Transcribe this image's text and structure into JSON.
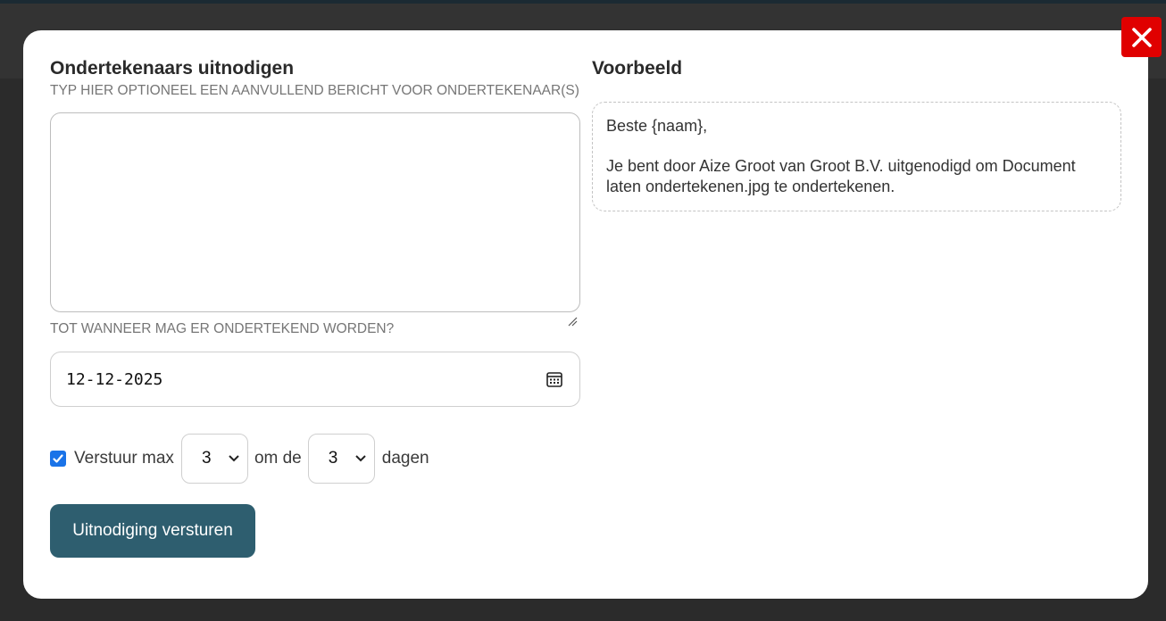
{
  "invite": {
    "title": "Ondertekenaars uitnodigen",
    "message_caption": "TYP HIER OPTIONEEL EEN AANVULLEND BERICHT VOOR ONDERTEKENAAR(S)",
    "message_value": "",
    "deadline_caption": "TOT WANNEER MAG ER ONDERTEKEND WORDEN?",
    "deadline_value": "12-12-2025",
    "reminder": {
      "checked": true,
      "label_prefix": "Verstuur max",
      "count_value": "3",
      "label_middle": "om de",
      "interval_value": "3",
      "label_suffix": "dagen"
    },
    "submit_label": "Uitnodiging versturen"
  },
  "preview": {
    "title": "Voorbeeld",
    "greeting": "Beste {naam},",
    "body": "Je bent door Aize Groot van Groot B.V. uitgenodigd om Document laten ondertekenen.jpg te ondertekenen."
  },
  "colors": {
    "close_button": "#e00000",
    "submit_button": "#2e5e6f",
    "checkbox": "#1a73e8"
  },
  "icons": {
    "close": "close-icon",
    "calendar": "calendar-icon",
    "chevron": "chevron-down-icon",
    "check": "check-icon"
  }
}
